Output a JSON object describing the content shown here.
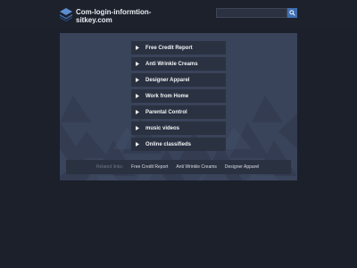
{
  "header": {
    "site_title": "Com-login-informtion-sitkey.com",
    "logo_icon": "stacked-layers-icon",
    "search": {
      "value": "",
      "placeholder": "",
      "button_icon": "search-icon"
    }
  },
  "links": [
    {
      "label": "Free Credit Report"
    },
    {
      "label": "Anti Wrinkle Creams"
    },
    {
      "label": "Designer Apparel"
    },
    {
      "label": "Work from Home"
    },
    {
      "label": "Parental Control"
    },
    {
      "label": "music videos"
    },
    {
      "label": "Online classifieds"
    }
  ],
  "related": {
    "title": "Related links:",
    "links": [
      {
        "label": "Free Credit Report"
      },
      {
        "label": "Anti Wrinkle Creams"
      },
      {
        "label": "Designer Apparel"
      }
    ]
  },
  "colors": {
    "background": "#1c202a",
    "panel": "#39435a",
    "link_background": "#2a3140",
    "accent": "#3f6fb0"
  }
}
